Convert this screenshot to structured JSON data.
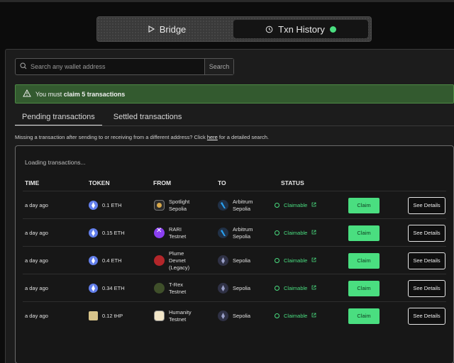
{
  "nav": {
    "bridge_label": "Bridge",
    "history_label": "Txn History"
  },
  "search": {
    "placeholder": "Search any wallet address",
    "value": "",
    "button_label": "Search"
  },
  "alert": {
    "prefix": "You must ",
    "bold": "claim 5 transactions"
  },
  "subtabs": {
    "pending": "Pending transactions",
    "settled": "Settled transactions"
  },
  "hint": {
    "before": "Missing a transaction after sending to or receiving from a different address? Click ",
    "link": "here",
    "after": " for a detailed search."
  },
  "table": {
    "loading": "Loading transactions...",
    "headers": [
      "TIME",
      "TOKEN",
      "FROM",
      "TO",
      "STATUS"
    ],
    "rows": [
      {
        "time": "a day ago",
        "token": "0.1 ETH",
        "from_l1": "Spotlight",
        "from_l2": "Sepolia",
        "from_l3": "",
        "to_l1": "Arbitrum",
        "to_l2": "Sepolia",
        "status": "Claimable",
        "claim": "Claim",
        "details": "See Details"
      },
      {
        "time": "a day ago",
        "token": "0.15 ETH",
        "from_l1": "RARI",
        "from_l2": "Testnet",
        "from_l3": "",
        "to_l1": "Arbitrum",
        "to_l2": "Sepolia",
        "status": "Claimable",
        "claim": "Claim",
        "details": "See Details"
      },
      {
        "time": "a day ago",
        "token": "0.4 ETH",
        "from_l1": "Plume",
        "from_l2": "Devnet",
        "from_l3": "(Legacy)",
        "to_l1": "Sepolia",
        "to_l2": "",
        "status": "Claimable",
        "claim": "Claim",
        "details": "See Details"
      },
      {
        "time": "a day ago",
        "token": "0.34 ETH",
        "from_l1": "T-Rex",
        "from_l2": "Testnet",
        "from_l3": "",
        "to_l1": "Sepolia",
        "to_l2": "",
        "status": "Claimable",
        "claim": "Claim",
        "details": "See Details"
      },
      {
        "time": "a day ago",
        "token": "0.12 tHP",
        "from_l1": "Humanity",
        "from_l2": "Testnet",
        "from_l3": "",
        "to_l1": "Sepolia",
        "to_l2": "",
        "status": "Claimable",
        "claim": "Claim",
        "details": "See Details"
      }
    ]
  },
  "colors": {
    "accent_green": "#4ade80",
    "alert_bg": "#335a2f"
  }
}
